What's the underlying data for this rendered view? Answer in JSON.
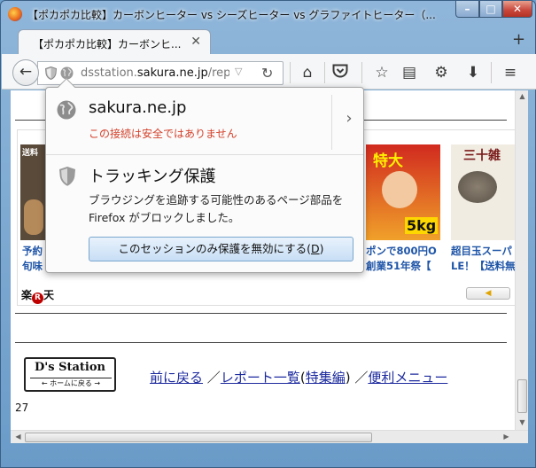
{
  "window": {
    "title": "【ポカポカ比較】カーボンヒーター vs シーズヒーター vs グラファイトヒーター（..."
  },
  "tab": {
    "title": "【ポカポカ比較】カーボンヒ...",
    "close": "✕"
  },
  "toolbar": {
    "url_prefix": "dsstation.",
    "url_domain": "sakura.ne.jp",
    "url_path": "/repor",
    "icons": [
      "home-icon",
      "pocket-icon",
      "bookmark-star-icon",
      "reading-list-icon",
      "gear-icon",
      "download-icon",
      "menu-icon"
    ]
  },
  "popup": {
    "site": "sakura.ne.jp",
    "warning": "この接続は安全ではありません",
    "tracking_title": "トラッキング保護",
    "tracking_desc": "ブラウジングを追跡する可能性のあるページ部品を Firefox がブロックしました。",
    "disable_button_text": "このセッションのみ保護を無効にする(",
    "disable_button_key": "D",
    "disable_button_close": ")"
  },
  "ads": {
    "items": [
      {
        "line1": "予約",
        "line2": "旬味"
      },
      {
        "line1": "ポンで800円O",
        "line2": "創業51年祭【"
      },
      {
        "line1": "超目玉スーパ",
        "line2": "LE！【送料無"
      }
    ],
    "sticker_1": "送料",
    "sticker_2": "特大",
    "sticker_3": "5kg",
    "sticker_4": "三十雑",
    "brand": "楽",
    "brand_r": "R",
    "brand_suffix": "天",
    "next_arrow": "◀"
  },
  "footer": {
    "logo_name": "D's Station",
    "logo_sub": "← ホームに戻る →",
    "link_prev": "前に戻る",
    "sep1": "／",
    "link_list": "レポート一覧",
    "paren_open": "(",
    "link_special": "特集編",
    "paren_close": ")",
    "sep2": "／",
    "link_menu": "便利メニュー",
    "count": "27"
  },
  "colors": {
    "warning": "#d3402a",
    "link": "#1c2a9e",
    "ad_link": "#1f55a8"
  }
}
